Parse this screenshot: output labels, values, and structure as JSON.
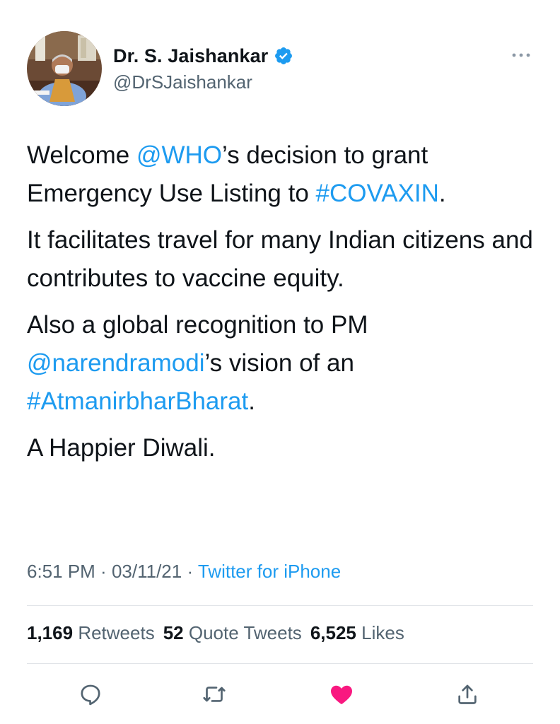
{
  "author": {
    "display_name": "Dr. S. Jaishankar",
    "handle": "@DrSJaishankar",
    "verified_icon": "verified-badge-icon"
  },
  "tweet": {
    "p1": {
      "pre": "Welcome ",
      "mention": "@WHO",
      "mid": "’s decision to grant Emergency Use Listing to ",
      "hashtag": "#COVAXIN",
      "post": "."
    },
    "p2": "It facilitates travel for many Indian citizens and contributes to vaccine equity.",
    "p3": {
      "pre": "Also a global recognition to PM ",
      "mention": "@narendramodi",
      "mid": "’s vision of an ",
      "hashtag": "#AtmanirbharBharat",
      "post": "."
    },
    "p4": "A Happier Diwali."
  },
  "meta": {
    "time": "6:51 PM",
    "sep1": " · ",
    "date": "03/11/21",
    "sep2": " · ",
    "source": "Twitter for iPhone"
  },
  "stats": {
    "retweets_count": "1,169",
    "retweets_label": "Retweets",
    "quotes_count": "52",
    "quotes_label": "Quote Tweets",
    "likes_count": "6,525",
    "likes_label": "Likes"
  },
  "colors": {
    "link": "#1d9bf0",
    "secondary_text": "#536471",
    "like_active": "#f91880"
  }
}
